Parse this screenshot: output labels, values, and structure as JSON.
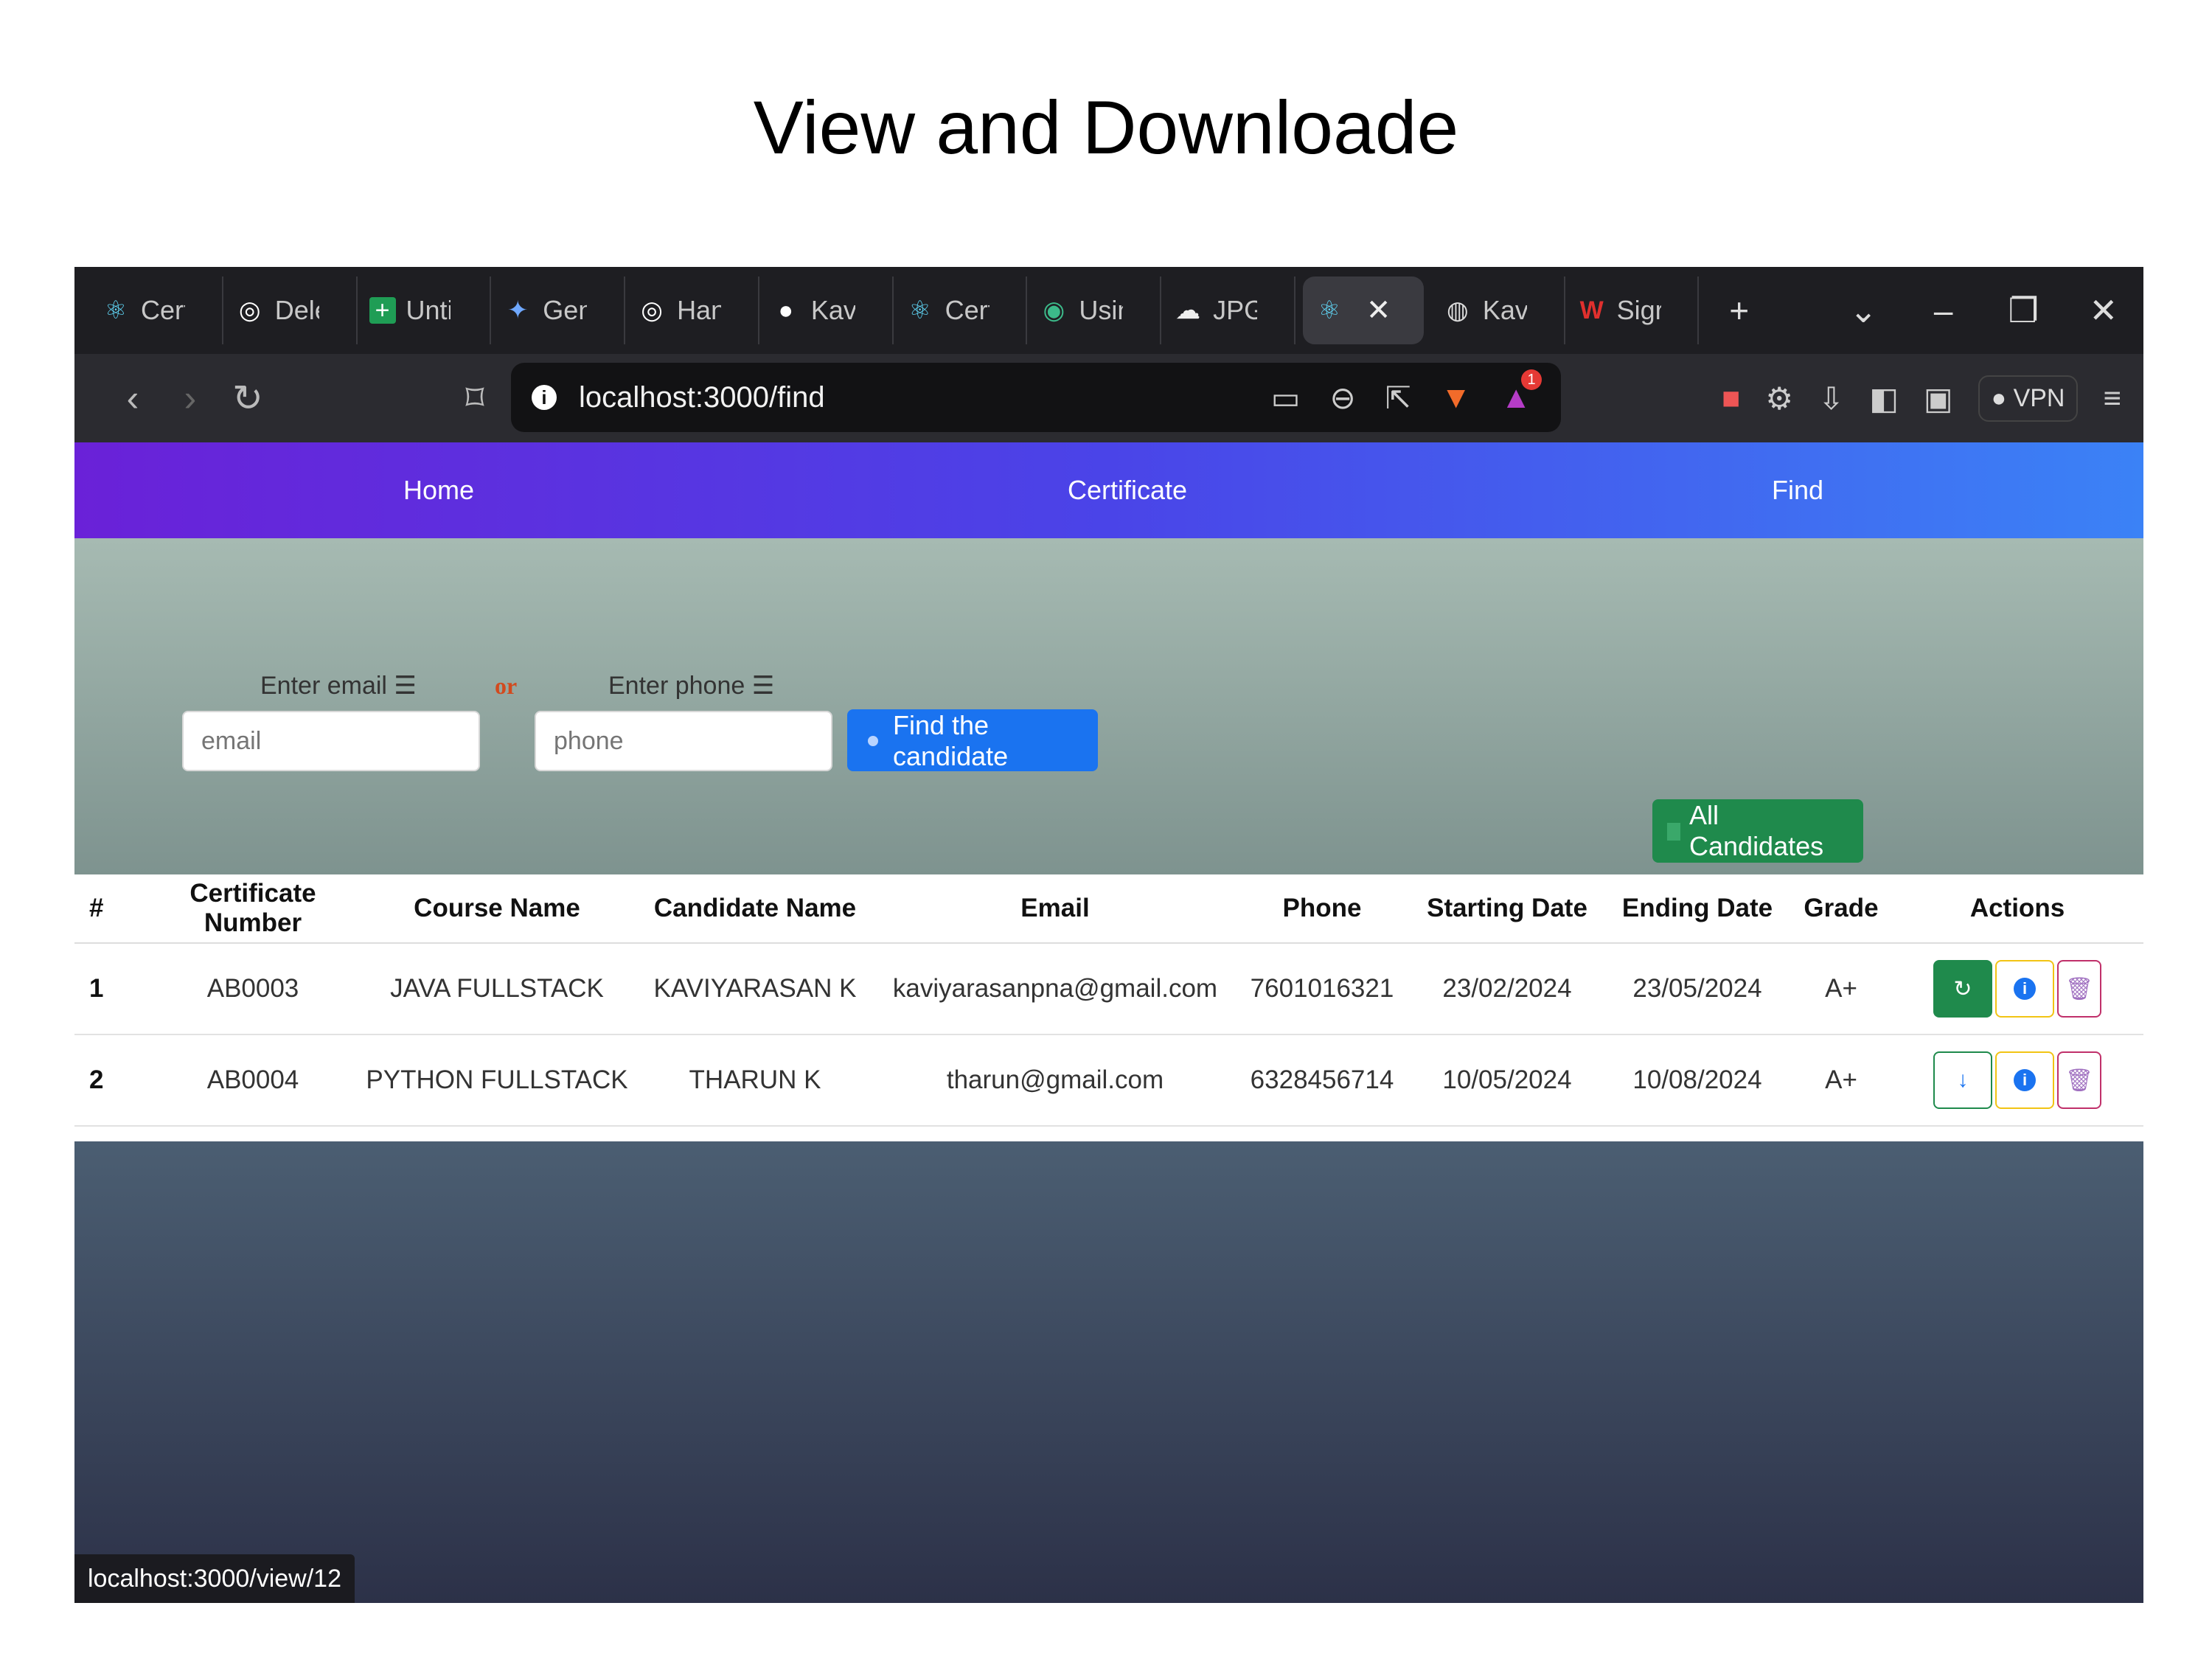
{
  "slide": {
    "title": "View and Downloade"
  },
  "browser": {
    "tabs": [
      {
        "label": "Cert",
        "icon": "react-icon"
      },
      {
        "label": "Dele",
        "icon": "chatgpt-icon"
      },
      {
        "label": "Unti",
        "icon": "sheets-icon"
      },
      {
        "label": "Gen",
        "icon": "gemini-icon"
      },
      {
        "label": "Han",
        "icon": "chatgpt-icon"
      },
      {
        "label": "Kavi",
        "icon": "github-icon"
      },
      {
        "label": "Cert",
        "icon": "react-icon"
      },
      {
        "label": "Usin",
        "icon": "shield-icon"
      },
      {
        "label": "JPG",
        "icon": "cloud-icon"
      },
      {
        "label": "",
        "icon": "react-icon",
        "active": true
      },
      {
        "label": "Kavi",
        "icon": "globe-icon"
      },
      {
        "label": "Sigr",
        "icon": "w-logo-icon"
      }
    ],
    "url": "localhost:3000/find",
    "vpn_label": "VPN",
    "notification_count": "1",
    "status_url": "localhost:3000/view/12"
  },
  "site_nav": {
    "home": "Home",
    "certificate": "Certificate",
    "find": "Find"
  },
  "search": {
    "email_label": "Enter email",
    "or_label": "or",
    "phone_label": "Enter phone",
    "email_placeholder": "email",
    "phone_placeholder": "phone",
    "find_button": "Find the candidate",
    "all_button": "All Candidates"
  },
  "table": {
    "headers": [
      "#",
      "Certificate Number",
      "Course Name",
      "Candidate Name",
      "Email",
      "Phone",
      "Starting Date",
      "Ending Date",
      "Grade",
      "Actions"
    ],
    "rows": [
      {
        "idx": "1",
        "cert": "AB0003",
        "course": "JAVA FULLSTACK",
        "name": "KAVIYARASAN K",
        "email": "kaviyarasanpna@gmail.com",
        "phone": "7601016321",
        "start": "23/02/2024",
        "end": "23/05/2024",
        "grade": "A+"
      },
      {
        "idx": "2",
        "cert": "AB0004",
        "course": "PYTHON FULLSTACK",
        "name": "THARUN K",
        "email": "tharun@gmail.com",
        "phone": "6328456714",
        "start": "10/05/2024",
        "end": "10/08/2024",
        "grade": "A+"
      }
    ]
  },
  "colors": {
    "accent": "#1a73f0",
    "success": "#1f8a4c",
    "nav_start": "#6a21d8",
    "nav_end": "#3b82f6"
  }
}
